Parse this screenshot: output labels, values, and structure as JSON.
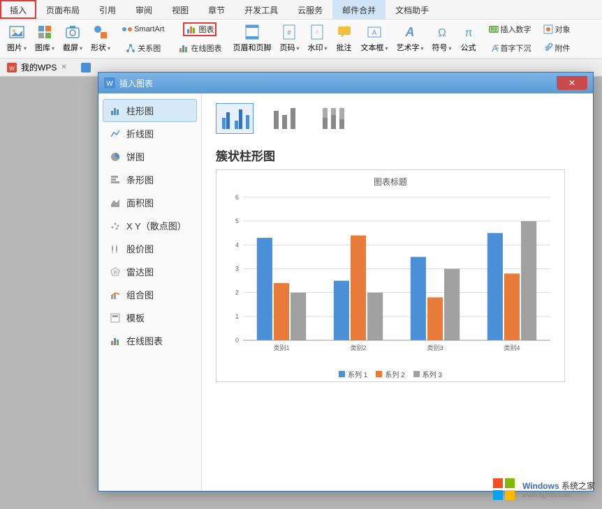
{
  "ribbon": {
    "tabs": [
      "插入",
      "页面布局",
      "引用",
      "审阅",
      "视图",
      "章节",
      "开发工具",
      "云服务",
      "邮件合并",
      "文档助手"
    ],
    "active_tab_index": 8,
    "highlighted_tab_index": 0
  },
  "toolbar": {
    "row_items": [
      "SmartArt",
      "图表",
      "在线图表"
    ],
    "highlighted_index": 1,
    "big_tools": [
      "图片",
      "图库",
      "截屏",
      "形状",
      "关系图",
      "页眉和页脚",
      "页码",
      "水印",
      "批注",
      "文本框",
      "艺术字",
      "符号",
      "公式"
    ],
    "right_items": [
      "插入数字",
      "对象",
      "首字下沉",
      "附件"
    ]
  },
  "doc_tabs": {
    "tab1": "我的WPS"
  },
  "dialog": {
    "title": "插入图表",
    "chart_types": [
      "柱形图",
      "折线图",
      "饼图",
      "条形图",
      "面积图",
      "X Y（散点图）",
      "股价图",
      "雷达图",
      "组合图",
      "模板",
      "在线图表"
    ],
    "selected_type_index": 0,
    "preview_title": "簇状柱形图",
    "chart_inner_title": "图表标题"
  },
  "chart_data": {
    "type": "bar",
    "categories": [
      "类别1",
      "类别2",
      "类别3",
      "类别4"
    ],
    "series": [
      {
        "name": "系列 1",
        "values": [
          4.3,
          2.5,
          3.5,
          4.5
        ],
        "color": "#4a90d9"
      },
      {
        "name": "系列 2",
        "values": [
          2.4,
          4.4,
          1.8,
          2.8
        ],
        "color": "#e87b3a"
      },
      {
        "name": "系列 3",
        "values": [
          2.0,
          2.0,
          3.0,
          5.0
        ],
        "color": "#a0a0a0"
      }
    ],
    "ylim": [
      0,
      6
    ],
    "yticks": [
      0,
      1,
      2,
      3,
      4,
      5,
      6
    ]
  },
  "watermark": {
    "brand": "Windows",
    "tagline": "系统之家",
    "url": "www.bjjmlv.com"
  },
  "colors": {
    "series1": "#4a90d9",
    "series2": "#e87b3a",
    "series3": "#a0a0a0"
  }
}
